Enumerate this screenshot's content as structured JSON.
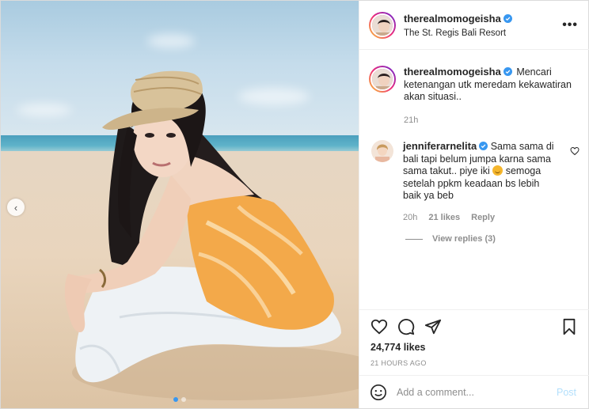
{
  "post": {
    "username": "therealmomogeisha",
    "location": "The St. Regis Bali Resort",
    "more_icon": "more-horizontal-icon",
    "caption_text": "Mencari ketenangan utk meredam kekawatiran akan situasi..",
    "caption_time": "21h",
    "likes": "24,774 likes",
    "time_ago": "21 HOURS AGO"
  },
  "reply": {
    "username": "jenniferarnelita",
    "text_before_emoji": "Sama sama di bali tapi belum jumpa karna sama sama takut.. piye iki",
    "text_after_emoji": "semoga setelah ppkm keadaan bs lebih baik ya beb",
    "time": "20h",
    "likes": "21 likes",
    "reply_label": "Reply",
    "view_replies": "View replies (3)"
  },
  "comment_box": {
    "placeholder": "Add a comment...",
    "post_label": "Post"
  },
  "carousel": {
    "total": 2,
    "active_index": 1,
    "prev_icon": "chevron-left-icon"
  },
  "colors": {
    "verified": "#3897f0",
    "post_disabled": "#b2dffc",
    "muted": "#8e8e8e"
  }
}
